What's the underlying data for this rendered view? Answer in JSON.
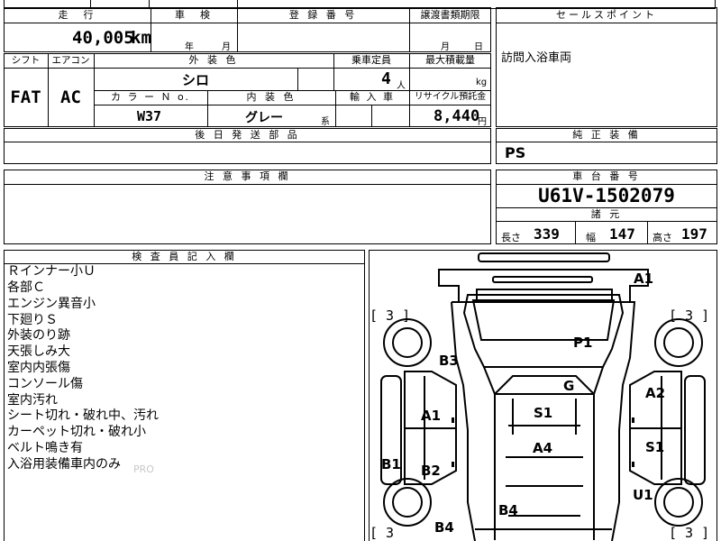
{
  "headers": {
    "mileage": "走　行",
    "inspection": "車　検",
    "registration": "登 録 番 号",
    "transfer_deadline": "譲渡書類期限",
    "sales_point": "セールスポイント",
    "shift": "シフト",
    "aircon": "エアコン",
    "exterior_color": "外 装 色",
    "capacity": "乗車定員",
    "max_load": "最大積載量",
    "color_no": "カ ラ ー Ｎ o.",
    "interior_color": "内 装 色",
    "import": "輸 入 車",
    "recycle": "リサイクル預託金",
    "later_parts": "後 日 発 送 部 品",
    "genuine_equipment": "純 正 装 備",
    "caution": "注 意 事 項 欄",
    "chassis_number": "車 台 番 号",
    "specs": "諸 元",
    "inspector_notes": "検 査 員 記 入 欄"
  },
  "vehicle": {
    "mileage_value": "40,005",
    "mileage_unit": "km",
    "year_label": "年",
    "month_label": "月",
    "transfer_month_label": "月",
    "transfer_day_label": "日",
    "shift": "FAT",
    "aircon": "AC",
    "exterior_color": "シロ",
    "capacity": "4",
    "capacity_unit": "人",
    "load_unit": "kg",
    "color_no": "W37",
    "interior_color": "グレー",
    "interior_suffix": "系",
    "recycle_fee": "8,440",
    "recycle_unit": "円",
    "sales_point": "訪問入浴車両",
    "genuine_equipment": "PS",
    "chassis_number": "U61V-1502079",
    "length_label": "長さ",
    "length": "339",
    "width_label": "幅",
    "width": "147",
    "height_label": "高さ",
    "height": "197"
  },
  "inspector_notes": [
    "Ｒインナー小Ｕ",
    "各部Ｃ",
    "エンジン異音小",
    "下廻りＳ",
    "外装のり跡",
    "天張しみ大",
    "室内内張傷",
    "コンソール傷",
    "室内汚れ",
    "シート切れ・破れ中、汚れ",
    "カーペット切れ・破れ小",
    "ベルト鳴き有",
    "入浴用装備車内のみ"
  ],
  "watermark": "PRO",
  "damage_codes": {
    "a1_top": "A1",
    "p1": "P1",
    "b3": "B3",
    "g": "G",
    "a2": "A2",
    "a1_left": "A1",
    "s1_center": "S1",
    "a4": "A4",
    "s1_right": "S1",
    "b1": "B1",
    "b2": "B2",
    "u1": "U1",
    "b4_center": "B4",
    "b4_left": "B4"
  },
  "tire_marks": {
    "front_left": "[ 3 ]",
    "front_right": "[ 3 ]",
    "rear_left": "[ 3",
    "rear_right": "[ 3 ]"
  }
}
